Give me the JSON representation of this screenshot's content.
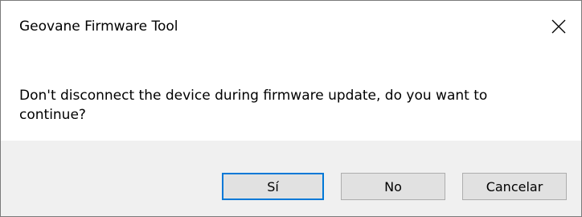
{
  "window": {
    "title": "Geovane Firmware Tool",
    "close_icon": "close-icon"
  },
  "message": {
    "text": "Don't disconnect the device during firmware update, do you want to continue?"
  },
  "buttons": {
    "yes_label": "Sí",
    "no_label": "No",
    "cancel_label": "Cancelar"
  },
  "colors": {
    "footer_background": "#f0f0f0",
    "button_background": "#e1e1e1",
    "default_button_border": "#0078d7"
  }
}
